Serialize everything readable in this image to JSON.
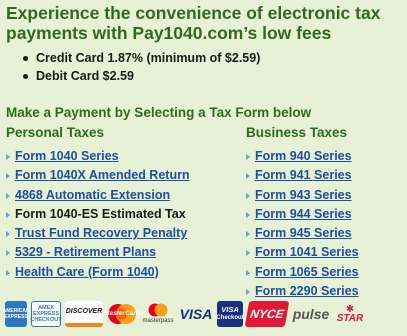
{
  "headline": {
    "line1": "Experience the convenience of electronic tax",
    "line2": "payments with Pay1040.com’s low fees"
  },
  "fees": [
    "Credit Card 1.87% (minimum of $2.59)",
    "Debit Card $2.59"
  ],
  "section_title": "Make a Payment by Selecting a Tax Form below",
  "personal": {
    "heading": "Personal Taxes",
    "items": [
      "Form 1040 Series",
      "Form 1040X Amended Return",
      "4868 Automatic Extension",
      "Form 1040-ES Estimated Tax",
      "Trust Fund Recovery Penalty",
      "5329 - Retirement Plans",
      "Health Care (Form 1040)"
    ]
  },
  "business": {
    "heading": "Business Taxes",
    "items": [
      "Form 940 Series",
      "Form 941 Series",
      "Form 943 Series",
      "Form 944 Series",
      "Form 945 Series",
      "Form 1041 Series",
      "Form 1065 Series",
      "Form 2290 Series"
    ]
  },
  "payment_logos": {
    "amex": "AMERICAN EXPRESS",
    "amex_checkout": "AMEX EXPRESS CHECKOUT",
    "discover": "DISCOVER",
    "mastercard_checkout": "MasterCard",
    "masterpass": "masterpass",
    "visa": "VISA",
    "visa_checkout_top": "VISA",
    "visa_checkout_bottom": "Checkout",
    "nyce": "NYCE",
    "pulse": "pulse",
    "star": "STAR"
  },
  "colors": {
    "background": "#e6f1d6",
    "heading_green": "#2f6b1f",
    "link_blue": "#1f4fa0"
  }
}
